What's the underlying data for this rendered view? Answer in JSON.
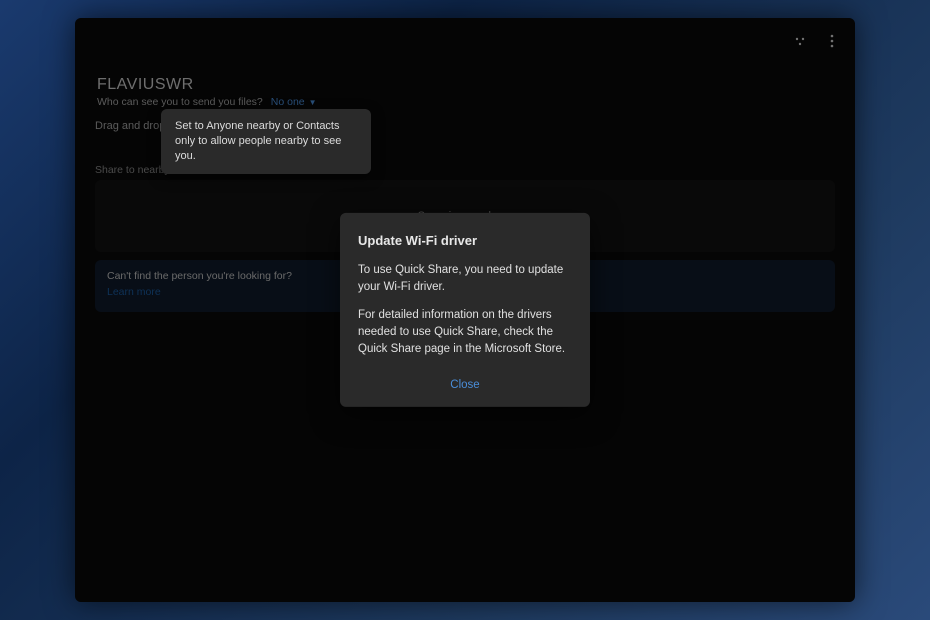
{
  "header": {
    "device_name": "FLAVIUSWR",
    "visibility_label": "Who can see you to send you files?",
    "visibility_value": "No one"
  },
  "drag_row": {
    "prefix": "Drag and drop f"
  },
  "tooltip": {
    "text": "Set to Anyone nearby or Contacts only to allow people nearby to see you."
  },
  "nearby": {
    "section_label": "Share to nearby devices",
    "scanning": "Scanning nearby ..."
  },
  "find": {
    "question": "Can't find the person you're looking for?",
    "learn_more": "Learn more"
  },
  "modal": {
    "title": "Update Wi-Fi driver",
    "para1": "To use Quick Share, you need to update your Wi-Fi driver.",
    "para2": "For detailed information on the drivers needed to use Quick Share, check the Quick Share page in the Microsoft Store.",
    "close": "Close"
  }
}
